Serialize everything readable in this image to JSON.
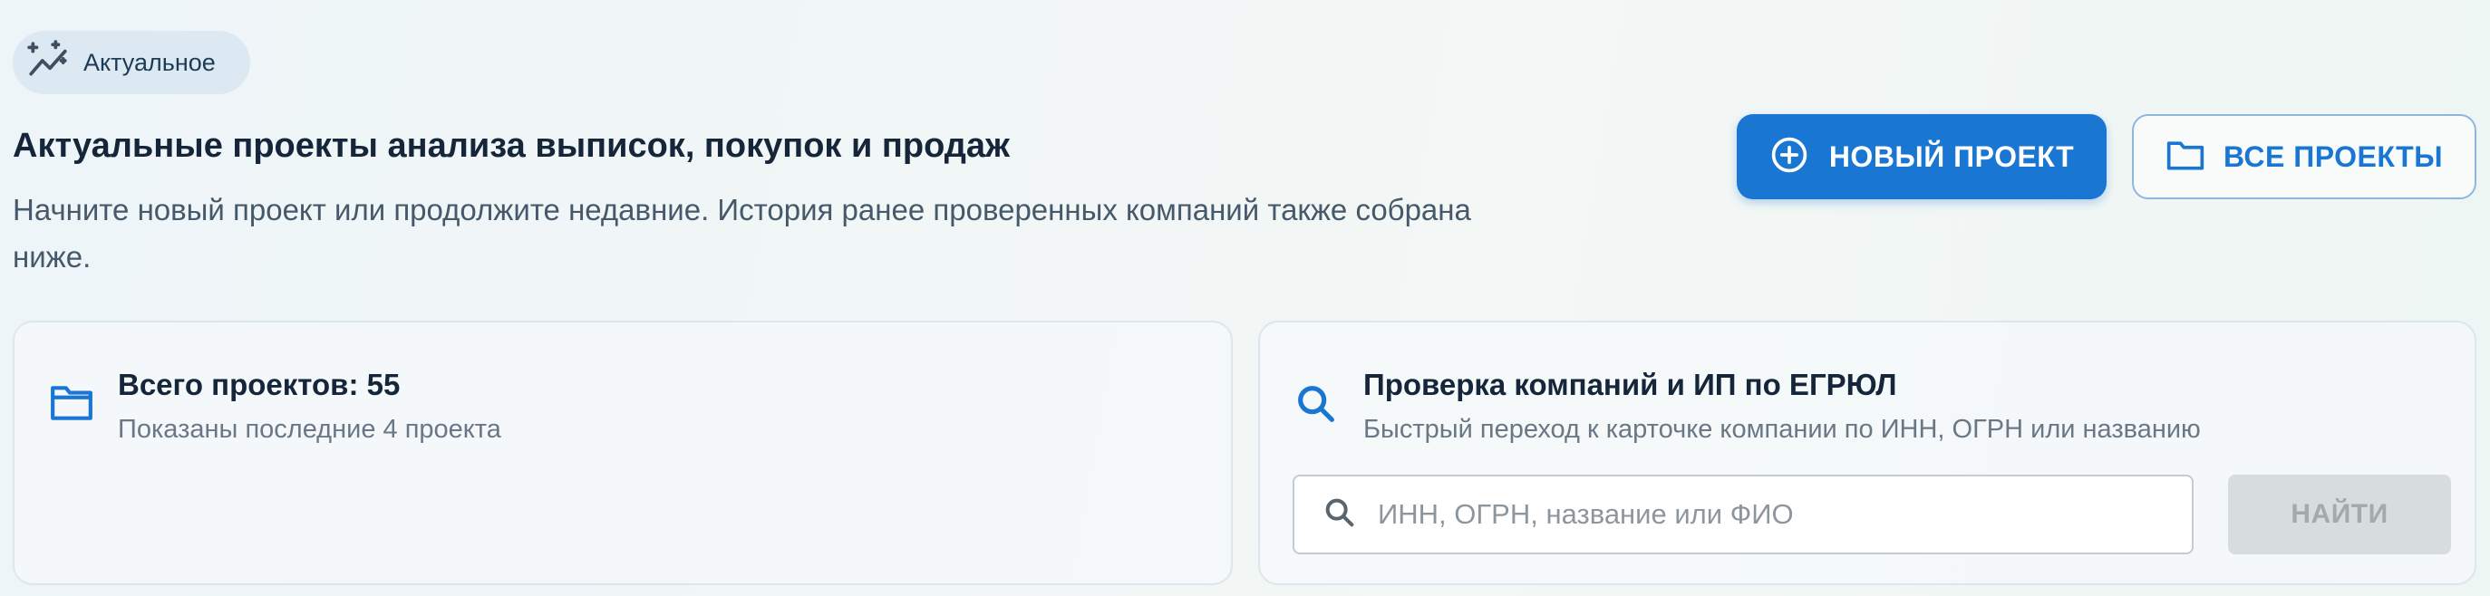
{
  "chip": {
    "icon": "sparkle-trend-icon",
    "label": "Актуальное"
  },
  "header": {
    "title": "Актуальные проекты анализа выписок, покупок и продаж",
    "subtitle": "Начните новый проект или продолжите недавние. История ранее проверенных компаний также собрана ниже."
  },
  "actions": {
    "new_project": {
      "icon": "add-circle-icon",
      "label": "НОВЫЙ ПРОЕКТ"
    },
    "all_projects": {
      "icon": "folder-icon",
      "label": "ВСЕ ПРОЕКТЫ"
    }
  },
  "projects_card": {
    "icon": "folder-icon",
    "title": "Всего проектов: 55",
    "subtitle": "Показаны последние 4 проекта"
  },
  "egrul_card": {
    "icon": "search-icon",
    "title": "Проверка компаний и ИП по ЕГРЮЛ",
    "subtitle": "Быстрый переход к карточке компании по ИНН, ОГРН или названию",
    "search": {
      "value": "",
      "placeholder": "ИНН, ОГРН, название или ФИО"
    },
    "find_label": "НАЙТИ"
  },
  "colors": {
    "primary": "#1976d2",
    "primary_outline": "#8fb7de",
    "disabled_bg": "#d7dcdc",
    "disabled_text": "#a4a9ab"
  }
}
